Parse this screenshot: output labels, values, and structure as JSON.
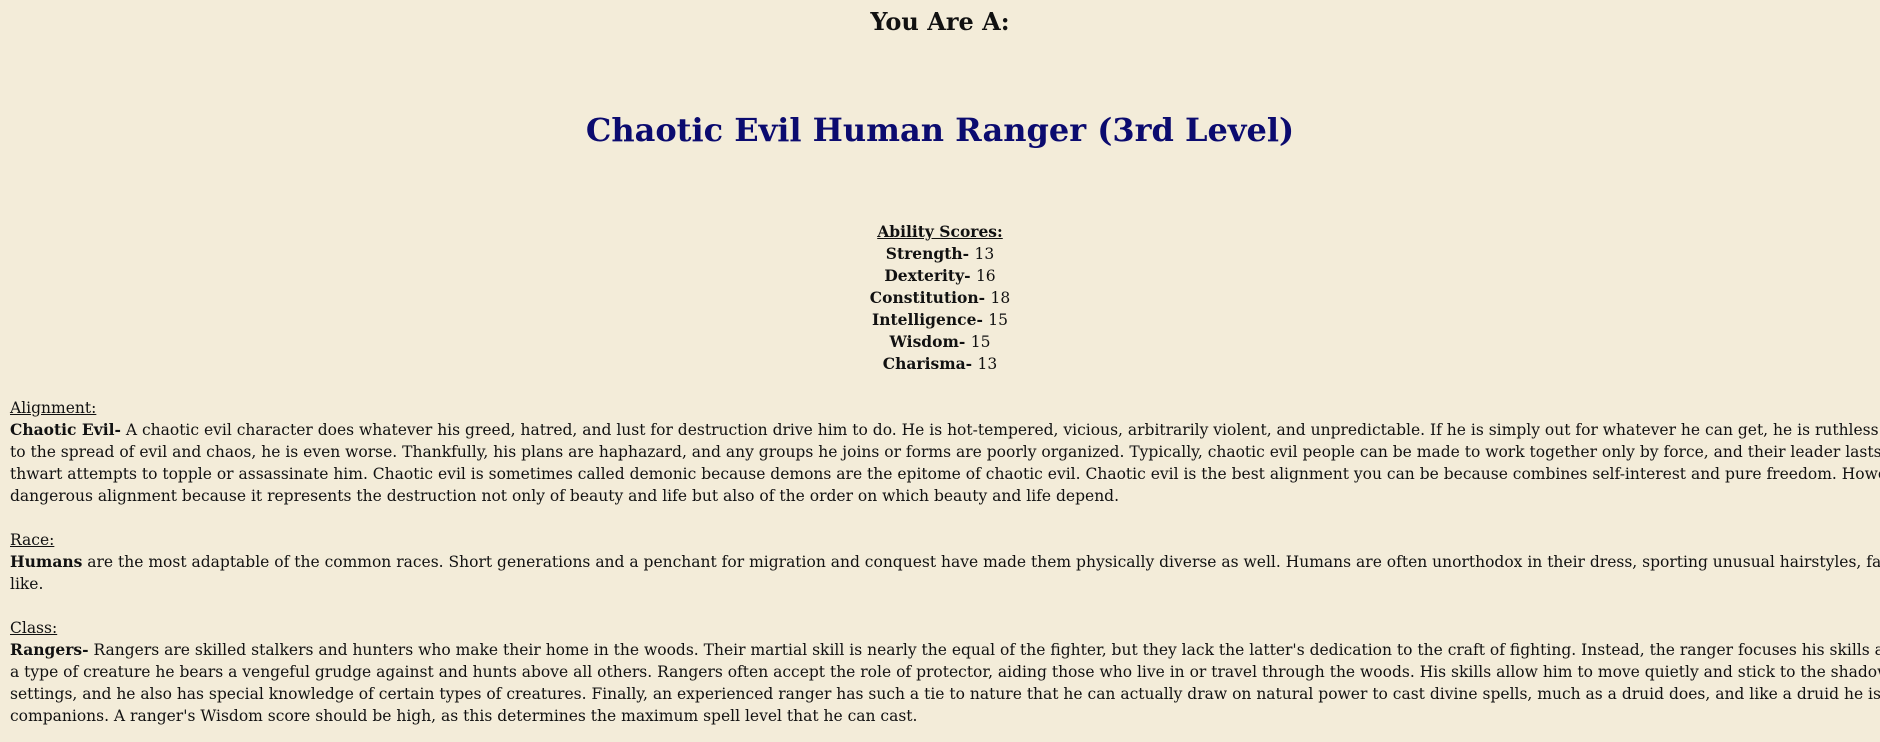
{
  "header": {
    "title": "You Are A:"
  },
  "result": {
    "headline": "Chaotic Evil Human Ranger (3rd Level)"
  },
  "abilities": {
    "heading": "Ability Scores:",
    "items": [
      {
        "name": "Strength-",
        "value": "13"
      },
      {
        "name": "Dexterity-",
        "value": "16"
      },
      {
        "name": "Constitution-",
        "value": "18"
      },
      {
        "name": "Intelligence-",
        "value": "15"
      },
      {
        "name": "Wisdom-",
        "value": "15"
      },
      {
        "name": "Charisma-",
        "value": "13"
      }
    ]
  },
  "alignment": {
    "label": "Alignment:",
    "lead": "Chaotic Evil-",
    "lines": [
      " A chaotic evil character does whatever his greed, hatred, and lust for destruction drive him to do. He is hot-tempered, vicious, arbitrarily violent, and unpredictable. If he is simply out for whatever he can get, he is ruthless and brutal. If he is committed",
      "to the spread of evil and chaos, he is even worse. Thankfully, his plans are haphazard, and any groups he joins or forms are poorly organized. Typically, chaotic evil people can be made to work together only by force, and their leader lasts only as long as he can",
      "thwart attempts to topple or assassinate him. Chaotic evil is sometimes called demonic because demons are the epitome of chaotic evil. Chaotic evil is the best alignment you can be because combines self-interest and pure freedom. However, chaotic evil can be a",
      "dangerous alignment because it represents the destruction not only of beauty and life but also of the order on which beauty and life depend."
    ]
  },
  "race": {
    "label": "Race:",
    "lead": "Humans",
    "lines": [
      " are the most adaptable of the common races. Short generations and a penchant for migration and conquest have made them physically diverse as well. Humans are often unorthodox in their dress, sporting unusual hairstyles, fanciful clothes, tattoos, and the",
      "like."
    ]
  },
  "class": {
    "label": "Class:",
    "lead": "Rangers-",
    "lines": [
      " Rangers are skilled stalkers and hunters who make their home in the woods. Their martial skill is nearly the equal of the fighter, but they lack the latter's dedication to the craft of fighting. Instead, the ranger focuses his skills and training on a specific enemy",
      "a type of creature he bears a vengeful grudge against and hunts above all others. Rangers often accept the role of protector, aiding those who live in or travel through the woods. His skills allow him to move quietly and stick to the shadows, especially in natural",
      "settings, and he also has special knowledge of certain types of creatures. Finally, an experienced ranger has such a tie to nature that he can actually draw on natural power to cast divine spells, much as a druid does, and like a druid he is often accompanied by animal",
      "companions. A ranger's Wisdom score should be high, as this determines the maximum spell level that he can cast."
    ]
  }
}
